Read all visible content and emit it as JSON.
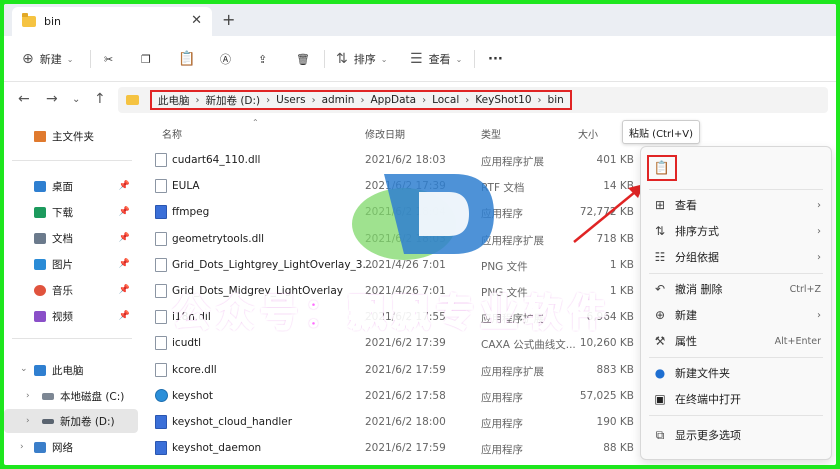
{
  "window": {
    "tab_title": "bin",
    "tab_close": "✕",
    "new_tab": "+"
  },
  "toolbar": {
    "new_label": "新建",
    "sort_label": "排序",
    "view_label": "查看",
    "more": "···"
  },
  "address": {
    "crumbs": [
      "此电脑",
      "新加卷 (D:)",
      "Users",
      "admin",
      "AppData",
      "Local",
      "KeyShot10",
      "bin"
    ]
  },
  "sidebar": {
    "home": "主文件夹",
    "items": [
      "桌面",
      "下载",
      "文档",
      "图片",
      "音乐",
      "视频"
    ],
    "this_pc": "此电脑",
    "drive_c": "本地磁盘 (C:)",
    "drive_d": "新加卷 (D:)",
    "network": "网络"
  },
  "columns": {
    "name": "名称",
    "date": "修改日期",
    "type": "类型",
    "size": "大小"
  },
  "files": [
    {
      "name": "cudart64_110.dll",
      "date": "2021/6/2 18:03",
      "type": "应用程序扩展",
      "size": "401 KB",
      "icon": "dll-icon"
    },
    {
      "name": "EULA",
      "date": "2021/6/2 17:39",
      "type": "RTF 文档",
      "size": "14 KB",
      "icon": "document-icon"
    },
    {
      "name": "ffmpeg",
      "date": "2021/6/2 18:04",
      "type": "应用程序",
      "size": "72,772 KB",
      "icon": "app-icon"
    },
    {
      "name": "geometrytools.dll",
      "date": "2021/6/2 18:03",
      "type": "应用程序扩展",
      "size": "718 KB",
      "icon": "dll-icon"
    },
    {
      "name": "Grid_Dots_Lightgrey_LightOverlay_3...",
      "date": "2021/4/26 7:01",
      "type": "PNG 文件",
      "size": "1 KB",
      "icon": "image-icon"
    },
    {
      "name": "Grid_Dots_Midgrey_LightOverlay",
      "date": "2021/4/26 7:01",
      "type": "PNG 文件",
      "size": "1 KB",
      "icon": "image-icon"
    },
    {
      "name": "i18n.dll",
      "date": "2021/6/2 17:55",
      "type": "应用程序扩展",
      "size": "6,964 KB",
      "icon": "dll-icon"
    },
    {
      "name": "icudtl",
      "date": "2021/6/2 17:39",
      "type": "CAXA 公式曲线文...",
      "size": "10,260 KB",
      "icon": "document-icon"
    },
    {
      "name": "kcore.dll",
      "date": "2021/6/2 17:59",
      "type": "应用程序扩展",
      "size": "883 KB",
      "icon": "dll-icon"
    },
    {
      "name": "keyshot",
      "date": "2021/6/2 17:58",
      "type": "应用程序",
      "size": "57,025 KB",
      "icon": "keyshot-icon"
    },
    {
      "name": "keyshot_cloud_handler",
      "date": "2021/6/2 18:00",
      "type": "应用程序",
      "size": "190 KB",
      "icon": "app-icon"
    },
    {
      "name": "keyshot_daemon",
      "date": "2021/6/2 17:59",
      "type": "应用程序",
      "size": "88 KB",
      "icon": "app-icon"
    }
  ],
  "context_menu": {
    "tooltip": "粘贴 (Ctrl+V)",
    "view": "查看",
    "sort": "排序方式",
    "group": "分组依据",
    "undo": "撤消 删除",
    "undo_key": "Ctrl+Z",
    "new": "新建",
    "properties": "属性",
    "properties_key": "Alt+Enter",
    "new_folder": "新建文件夹",
    "open_terminal": "在终端中打开",
    "more_options": "显示更多选项"
  },
  "watermark": {
    "text": "公众号：飘飘专业软件"
  },
  "colors": {
    "accent_red": "#e02424",
    "frame_green": "#1ee61e",
    "folder_yellow": "#f5c342",
    "watermark_pink": "#ff5cff"
  }
}
